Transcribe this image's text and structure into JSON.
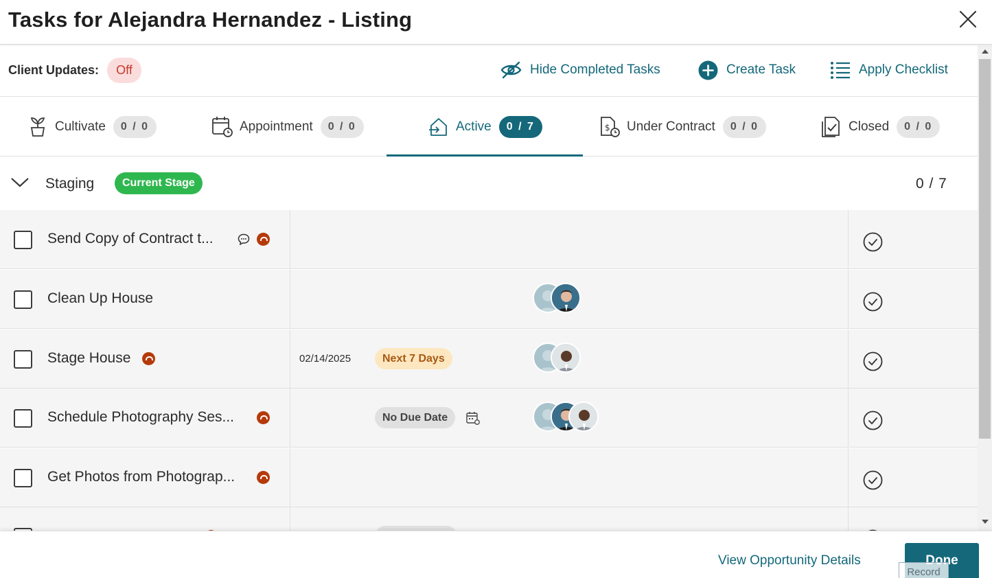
{
  "header": {
    "title": "Tasks for Alejandra Hernandez - Listing"
  },
  "toolbar": {
    "client_updates_label": "Client Updates:",
    "client_updates_value": "Off",
    "hide_completed": "Hide Completed Tasks",
    "create_task": "Create Task",
    "apply_checklist": "Apply Checklist"
  },
  "tabs": [
    {
      "label": "Cultivate",
      "count": "0 / 0",
      "icon": "sprout-icon"
    },
    {
      "label": "Appointment",
      "count": "0 / 0",
      "icon": "calendar-clock-icon"
    },
    {
      "label": "Active",
      "count": "0 / 7",
      "icon": "house-arrow-icon",
      "active": true
    },
    {
      "label": "Under Contract",
      "count": "0 / 0",
      "icon": "document-dollar-icon"
    },
    {
      "label": "Closed",
      "count": "0 / 0",
      "icon": "document-check-icon"
    }
  ],
  "stage": {
    "name": "Staging",
    "badge": "Current Stage",
    "count": "0 / 7"
  },
  "tasks": [
    {
      "name": "Send Copy of Contract t...",
      "date": "",
      "status": "",
      "comment_icon": true,
      "priority_icon": true
    },
    {
      "name": "Clean Up House",
      "date": "",
      "status": ""
    },
    {
      "name": "Stage House",
      "date": "02/14/2025",
      "status": "Next 7 Days",
      "priority_icon": true
    },
    {
      "name": "Schedule Photography Ses...",
      "date": "",
      "status": "No Due Date",
      "priority_icon": true
    },
    {
      "name": "Get Photos from Photograp...",
      "date": "",
      "status": "",
      "priority_icon": true
    }
  ],
  "footer": {
    "view_details": "View Opportunity Details",
    "done": "Done",
    "record": "Record"
  },
  "colors": {
    "accent": "#14687a",
    "current_stage": "#2fb74f",
    "priority": "#b53a0a",
    "client_updates_off_bg": "#fbdcdc",
    "next7_bg": "#fde7c0"
  }
}
